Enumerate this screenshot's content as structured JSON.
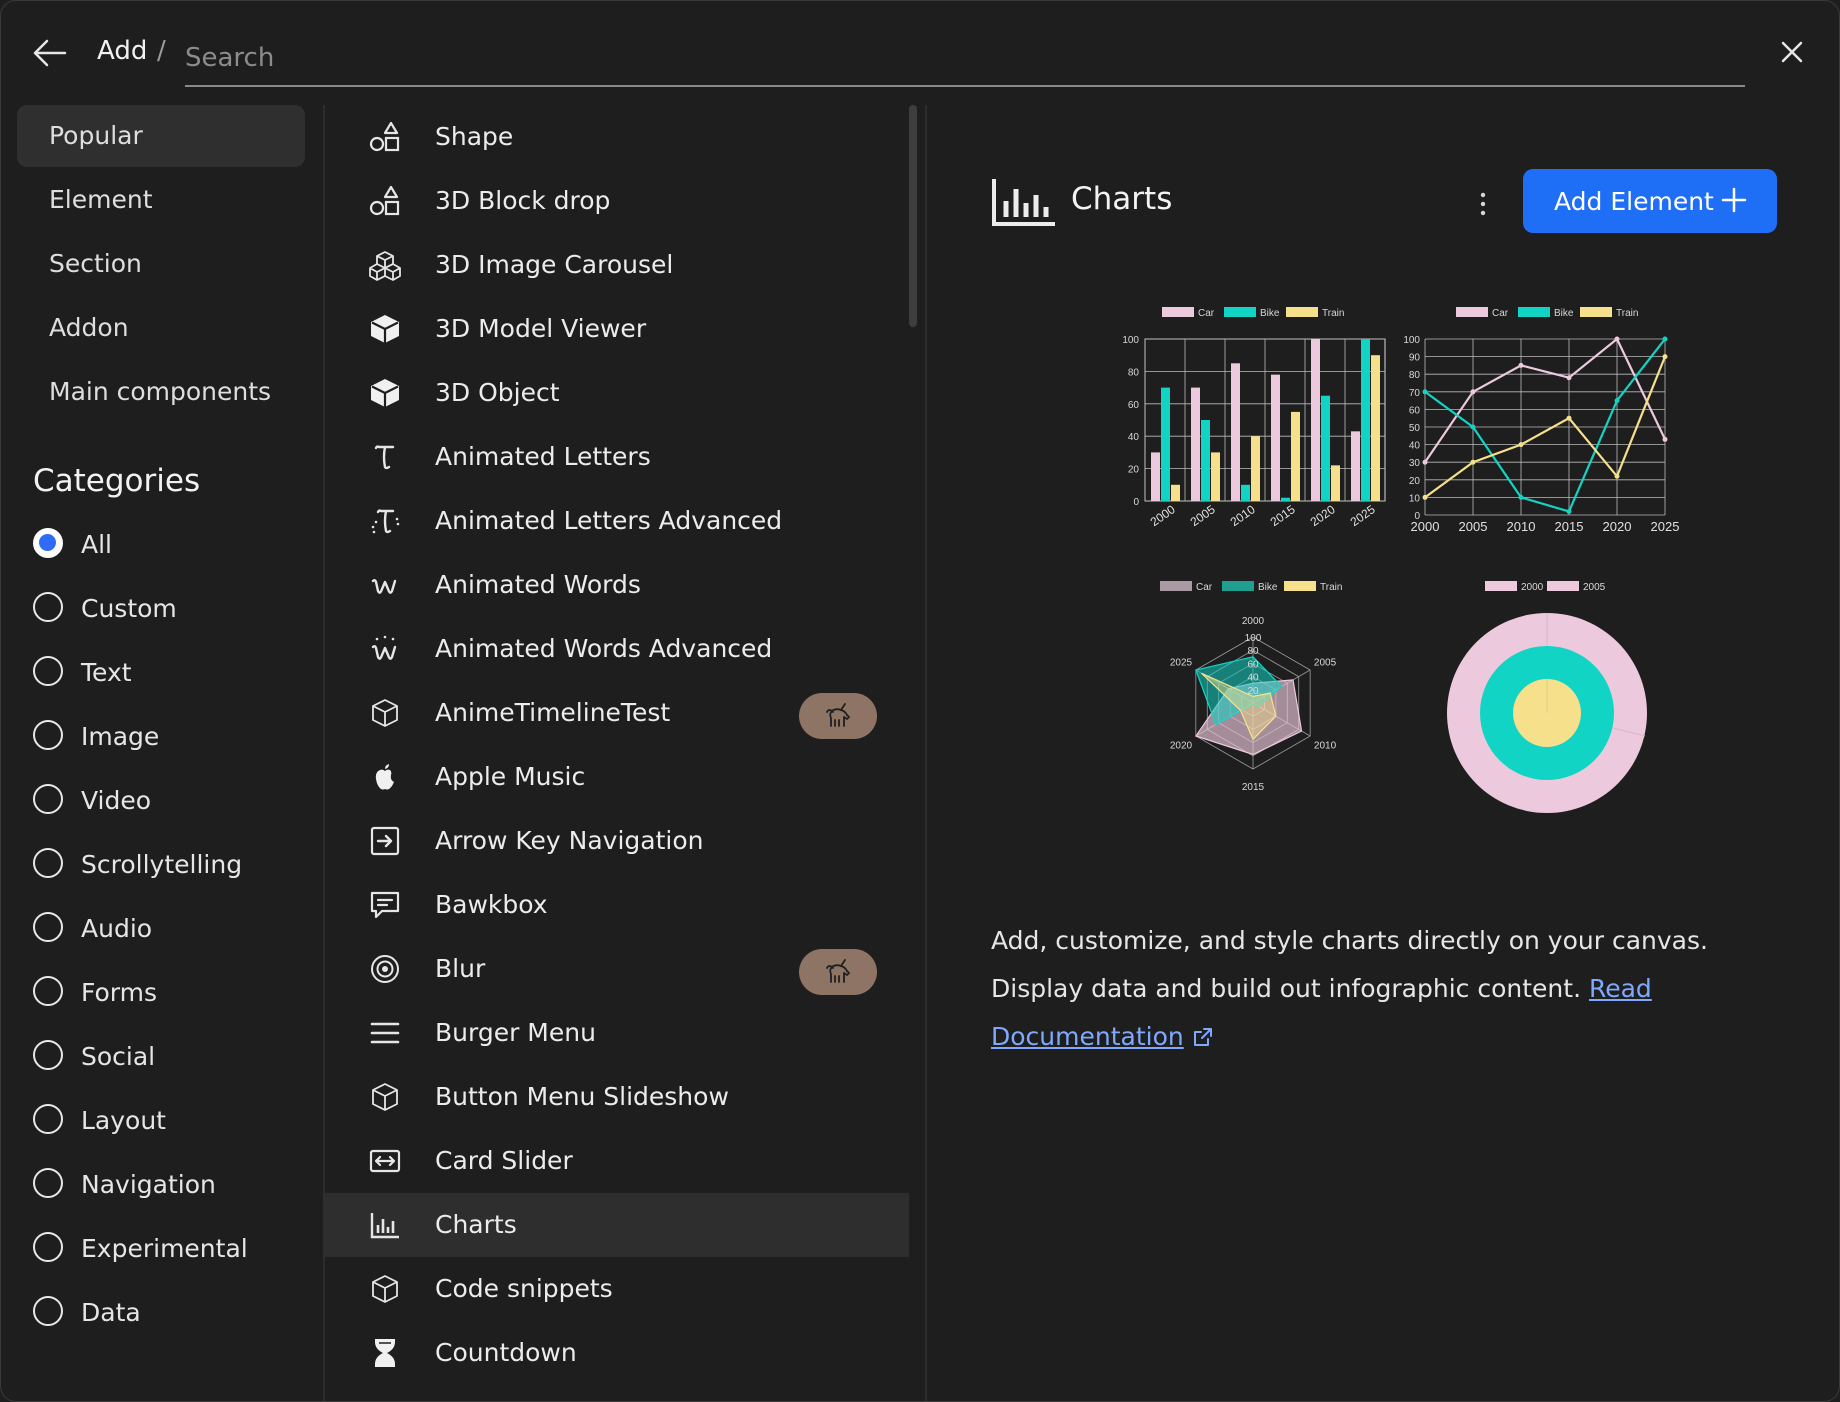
{
  "header": {
    "crumb": "Add",
    "separator": "/",
    "search_placeholder": "Search"
  },
  "sidebar": {
    "items": [
      {
        "label": "Popular",
        "active": true
      },
      {
        "label": "Element",
        "active": false
      },
      {
        "label": "Section",
        "active": false
      },
      {
        "label": "Addon",
        "active": false
      },
      {
        "label": "Main components",
        "active": false
      }
    ],
    "categories_title": "Categories",
    "categories": [
      {
        "label": "All",
        "selected": true
      },
      {
        "label": "Custom",
        "selected": false
      },
      {
        "label": "Text",
        "selected": false
      },
      {
        "label": "Image",
        "selected": false
      },
      {
        "label": "Video",
        "selected": false
      },
      {
        "label": "Scrollytelling",
        "selected": false
      },
      {
        "label": "Audio",
        "selected": false
      },
      {
        "label": "Forms",
        "selected": false
      },
      {
        "label": "Social",
        "selected": false
      },
      {
        "label": "Layout",
        "selected": false
      },
      {
        "label": "Navigation",
        "selected": false
      },
      {
        "label": "Experimental",
        "selected": false
      },
      {
        "label": "Data",
        "selected": false
      }
    ]
  },
  "elements": [
    {
      "label": "Shape",
      "icon": "shapes-icon"
    },
    {
      "label": "3D Block drop",
      "icon": "shapes-icon"
    },
    {
      "label": "3D Image Carousel",
      "icon": "cubes-icon"
    },
    {
      "label": "3D Model Viewer",
      "icon": "cube-solid-icon"
    },
    {
      "label": "3D Object",
      "icon": "cube-solid-icon"
    },
    {
      "label": "Animated Letters",
      "icon": "text-t-icon"
    },
    {
      "label": "Animated Letters Advanced",
      "icon": "text-t-sparkle-icon"
    },
    {
      "label": "Animated Words",
      "icon": "words-w-icon"
    },
    {
      "label": "Animated Words Advanced",
      "icon": "words-w-sparkle-icon"
    },
    {
      "label": "AnimeTimelineTest",
      "icon": "cube-outline-icon",
      "badge": "unicorn-icon"
    },
    {
      "label": "Apple Music",
      "icon": "apple-icon"
    },
    {
      "label": "Arrow Key Navigation",
      "icon": "arrow-box-icon"
    },
    {
      "label": "Bawkbox",
      "icon": "chat-bubble-icon"
    },
    {
      "label": "Blur",
      "icon": "blur-circle-icon",
      "badge": "unicorn-icon"
    },
    {
      "label": "Burger Menu",
      "icon": "hamburger-icon"
    },
    {
      "label": "Button Menu Slideshow",
      "icon": "cube-outline-icon"
    },
    {
      "label": "Card Slider",
      "icon": "slider-icon"
    },
    {
      "label": "Charts",
      "icon": "bar-chart-icon",
      "selected": true
    },
    {
      "label": "Code snippets",
      "icon": "cube-outline-icon"
    },
    {
      "label": "Countdown",
      "icon": "hourglass-icon"
    }
  ],
  "detail": {
    "title": "Charts",
    "add_button": "Add Element",
    "description": "Add, customize, and style charts directly on your canvas. Display data and build out infographic content.",
    "doc_link": "Read Documentation",
    "colors": {
      "accent": "#1e6ef6",
      "car": "#ecc9dc",
      "bike": "#12d4c4",
      "train": "#f6e08c",
      "link": "#7fa8ff"
    }
  },
  "chart_data": [
    {
      "type": "bar",
      "categories": [
        "2000",
        "2005",
        "2010",
        "2015",
        "2020",
        "2025"
      ],
      "series": [
        {
          "name": "Car",
          "values": [
            30,
            70,
            85,
            78,
            100,
            43
          ]
        },
        {
          "name": "Bike",
          "values": [
            70,
            50,
            10,
            2,
            65,
            100
          ]
        },
        {
          "name": "Train",
          "values": [
            10,
            30,
            40,
            55,
            22,
            90
          ]
        }
      ],
      "ylim": [
        0,
        100
      ],
      "yticks": [
        "0",
        "20",
        "40",
        "60",
        "80",
        "100"
      ],
      "legend": "top"
    },
    {
      "type": "line",
      "categories": [
        "2000",
        "2005",
        "2010",
        "2015",
        "2020",
        "2025"
      ],
      "series": [
        {
          "name": "Car",
          "values": [
            30,
            70,
            85,
            78,
            100,
            43
          ]
        },
        {
          "name": "Bike",
          "values": [
            70,
            50,
            10,
            2,
            65,
            100
          ]
        },
        {
          "name": "Train",
          "values": [
            10,
            30,
            40,
            55,
            22,
            90
          ]
        }
      ],
      "ylim": [
        0,
        100
      ],
      "yticks": [
        "0",
        "10",
        "20",
        "30",
        "40",
        "50",
        "60",
        "70",
        "80",
        "90",
        "100"
      ],
      "legend": "top"
    },
    {
      "type": "radar",
      "categories": [
        "2000",
        "2005",
        "2010",
        "2015",
        "2020",
        "2025"
      ],
      "series": [
        {
          "name": "Car",
          "values": [
            30,
            70,
            85,
            78,
            100,
            43
          ]
        },
        {
          "name": "Bike",
          "values": [
            70,
            50,
            10,
            2,
            65,
            100
          ]
        },
        {
          "name": "Train",
          "values": [
            10,
            30,
            40,
            55,
            22,
            90
          ]
        }
      ],
      "rticks": [
        "20",
        "40",
        "60",
        "80",
        "100"
      ],
      "legend": "top"
    },
    {
      "type": "pie",
      "variant": "doughnut",
      "legend_items": [
        "2000",
        "2005"
      ],
      "rings": [
        {
          "values": [
            100,
            0
          ],
          "color": "#ecc9dc"
        },
        {
          "values": [
            100
          ],
          "color": "#12d4c4"
        },
        {
          "values": [
            100
          ],
          "color": "#f6e08c"
        }
      ],
      "legend": "top"
    }
  ]
}
